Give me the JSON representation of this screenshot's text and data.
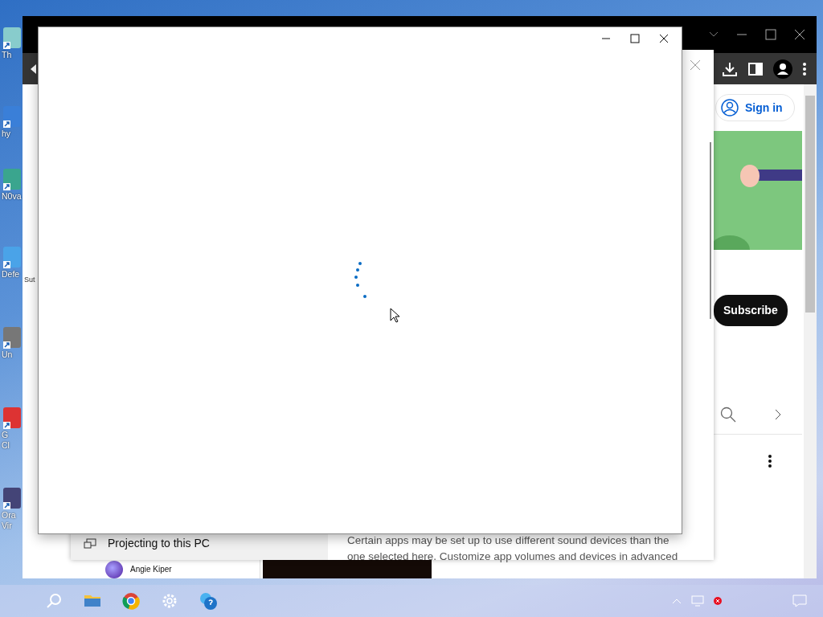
{
  "desktop": {
    "icons": [
      {
        "lines": [
          "Th"
        ]
      },
      {
        "lines": [
          "hy"
        ]
      },
      {
        "lines": [
          "N0va"
        ]
      },
      {
        "lines": [
          "Defe"
        ]
      },
      {
        "lines": [
          "Un"
        ]
      },
      {
        "lines": [
          "G",
          "Cl"
        ]
      },
      {
        "lines": [
          "Ora",
          "Vir"
        ]
      }
    ]
  },
  "browser": {
    "side_label": "Sut",
    "sign_in": "Sign in",
    "subscribe": "Subscribe",
    "channel_name": "Angie Kiper"
  },
  "settings": {
    "nav_item": "Projecting to this PC",
    "description": [
      "Certain apps may be set up to use different sound devices than the",
      "one selected here. Customize app volumes and devices in advanced"
    ]
  },
  "taskbar": {
    "apps": [
      {
        "kind": "search"
      },
      {
        "kind": "folder"
      },
      {
        "kind": "browser"
      },
      {
        "kind": "settings"
      },
      {
        "kind": "help"
      }
    ]
  }
}
